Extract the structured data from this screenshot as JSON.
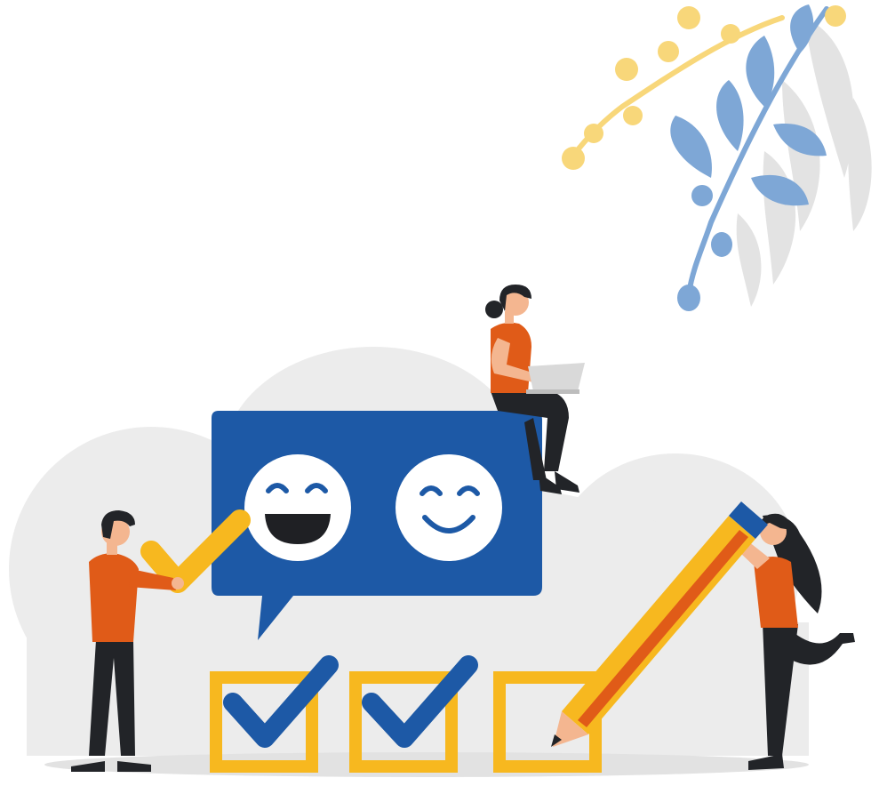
{
  "illustration": {
    "subject": "survey-feedback-checklist",
    "colors": {
      "blue": "#1d59a6",
      "blue_light": "#7ea7d6",
      "orange": "#e05b18",
      "yellow": "#f7b81f",
      "yellow_soft": "#f8d77a",
      "dark": "#222428",
      "skin": "#f4b690",
      "hair": "#222428",
      "cloud": "#ececec",
      "white": "#ffffff"
    },
    "checkboxes": [
      {
        "checked": true
      },
      {
        "checked": true
      },
      {
        "checked": false
      }
    ],
    "faces": [
      "laughing-face-icon",
      "smiling-face-icon"
    ]
  }
}
